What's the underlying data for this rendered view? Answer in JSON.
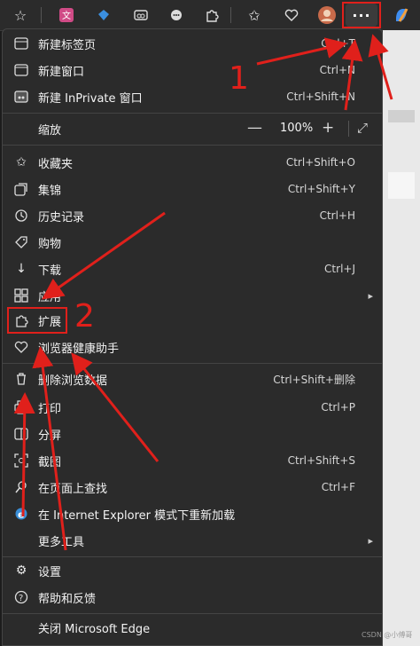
{
  "toolbar": {
    "icons": [
      "star-add-icon",
      "translate-icon",
      "diamond-icon",
      "reading-icon",
      "chat-icon",
      "extensions-icon",
      "favorites-icon",
      "health-icon",
      "profile-avatar",
      "more-icon",
      "copilot-icon"
    ],
    "more_label": "···"
  },
  "menu": {
    "items": [
      {
        "label": "新建标签页",
        "shortcut": "Ctrl+T",
        "icon": "new-tab-icon"
      },
      {
        "label": "新建窗口",
        "shortcut": "Ctrl+N",
        "icon": "new-window-icon"
      },
      {
        "label": "新建 InPrivate 窗口",
        "shortcut": "Ctrl+Shift+N",
        "icon": "inprivate-icon"
      },
      {
        "label": "缩放",
        "icon": ""
      },
      {
        "label": "收藏夹",
        "shortcut": "Ctrl+Shift+O",
        "icon": "favorites-icon"
      },
      {
        "label": "集锦",
        "shortcut": "Ctrl+Shift+Y",
        "icon": "collections-icon"
      },
      {
        "label": "历史记录",
        "shortcut": "Ctrl+H",
        "icon": "history-icon"
      },
      {
        "label": "购物",
        "shortcut": "",
        "icon": "shopping-icon"
      },
      {
        "label": "下载",
        "shortcut": "Ctrl+J",
        "icon": "download-icon"
      },
      {
        "label": "应用",
        "shortcut": "",
        "icon": "apps-icon"
      },
      {
        "label": "扩展",
        "shortcut": "",
        "icon": "extensions-icon"
      },
      {
        "label": "浏览器健康助手",
        "shortcut": "",
        "icon": "health-icon"
      },
      {
        "label": "删除浏览数据",
        "shortcut": "Ctrl+Shift+删除",
        "icon": "trash-icon"
      },
      {
        "label": "打印",
        "shortcut": "Ctrl+P",
        "icon": "print-icon"
      },
      {
        "label": "分屏",
        "shortcut": "",
        "icon": "split-screen-icon"
      },
      {
        "label": "截图",
        "shortcut": "Ctrl+Shift+S",
        "icon": "screenshot-icon"
      },
      {
        "label": "在页面上查找",
        "shortcut": "Ctrl+F",
        "icon": "find-icon"
      },
      {
        "label": "在 Internet Explorer 模式下重新加载",
        "shortcut": "",
        "icon": "ie-icon"
      },
      {
        "label": "更多工具",
        "shortcut": "",
        "icon": ""
      },
      {
        "label": "设置",
        "shortcut": "",
        "icon": "settings-icon"
      },
      {
        "label": "帮助和反馈",
        "shortcut": "",
        "icon": "help-icon"
      },
      {
        "label": "关闭 Microsoft Edge",
        "shortcut": "",
        "icon": ""
      }
    ],
    "zoom": {
      "value": "100%",
      "minus": "—",
      "plus": "+"
    }
  },
  "annotations": {
    "num1": "1",
    "num2": "2",
    "color": "#e0201b"
  },
  "watermark": "CSDN @小傅哥"
}
